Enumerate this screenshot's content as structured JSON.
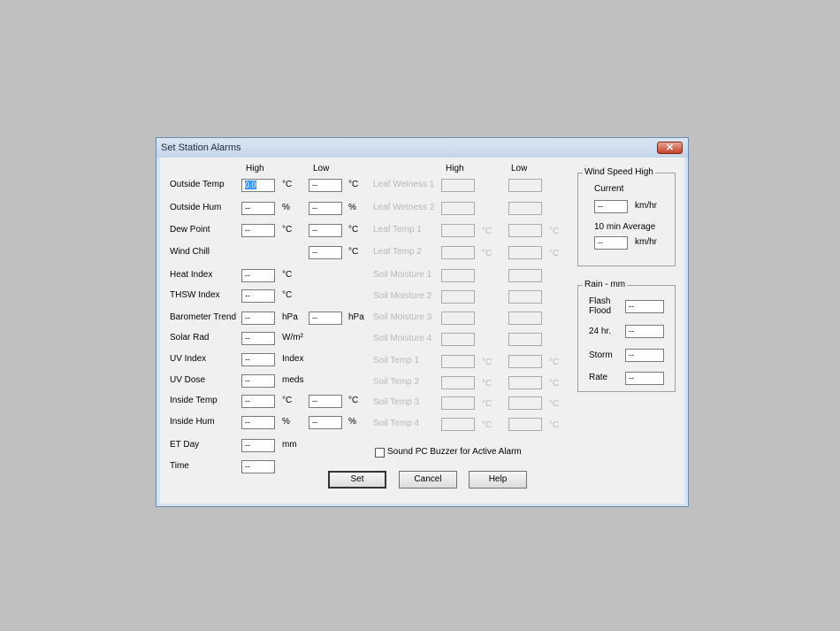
{
  "dialog": {
    "title": "Set Station Alarms",
    "close": "✕"
  },
  "headers": {
    "high": "High",
    "low": "Low",
    "high2": "High",
    "low2": "Low"
  },
  "rows": [
    {
      "label": "Outside Temp",
      "high": "0.0",
      "unit_high": "°C",
      "low": "--",
      "unit_low": "°C"
    },
    {
      "label": "Outside Hum",
      "high": "--",
      "unit_high": "%",
      "low": "--",
      "unit_low": "%"
    },
    {
      "label": "Dew Point",
      "high": "--",
      "unit_high": "°C",
      "low": "--",
      "unit_low": "°C"
    },
    {
      "label": "Wind Chill",
      "low": "--",
      "unit_low": "°C"
    },
    {
      "label": "Heat Index",
      "high": "--",
      "unit_high": "°C"
    },
    {
      "label": "THSW Index",
      "high": "--",
      "unit_high": "°C"
    },
    {
      "label": "Barometer Trend",
      "high": "--",
      "unit_high": "hPa",
      "low": "--",
      "unit_low": "hPa"
    },
    {
      "label": "Solar Rad",
      "high": "--",
      "unit_high": "W/m²"
    },
    {
      "label": "UV Index",
      "high": "--",
      "unit_high": "Index"
    },
    {
      "label": "UV Dose",
      "high": "--",
      "unit_high": "meds"
    },
    {
      "label": "Inside Temp",
      "high": "--",
      "unit_high": "°C",
      "low": "--",
      "unit_low": "°C"
    },
    {
      "label": "Inside Hum",
      "high": "--",
      "unit_high": "%",
      "low": "--",
      "unit_low": "%"
    },
    {
      "label": "ET Day",
      "high": "--",
      "unit_high": "mm"
    },
    {
      "label": "Time",
      "high": "--"
    }
  ],
  "extra_rows": [
    {
      "label": "Leaf Wetness 1",
      "unit": ""
    },
    {
      "label": "Leaf Wetness 2",
      "unit": ""
    },
    {
      "label": "Leaf Temp 1",
      "unit": "°C"
    },
    {
      "label": "Leaf Temp 2",
      "unit": "°C"
    },
    {
      "label": "Soil Moisture 1",
      "unit": ""
    },
    {
      "label": "Soil Moisture 2",
      "unit": ""
    },
    {
      "label": "Soil Moisture 3",
      "unit": ""
    },
    {
      "label": "Soil Moisture 4",
      "unit": ""
    },
    {
      "label": "Soil Temp 1",
      "unit": "°C"
    },
    {
      "label": "Soil Temp 2",
      "unit": "°C"
    },
    {
      "label": "Soil Temp 3",
      "unit": "°C"
    },
    {
      "label": "Soil Temp 4",
      "unit": "°C"
    }
  ],
  "wind": {
    "title": "Wind Speed High",
    "current_label": "Current",
    "current_value": "--",
    "current_unit": "km/hr",
    "avg_label": "10 min Average",
    "avg_value": "--",
    "avg_unit": "km/hr"
  },
  "rain": {
    "title": "Rain - mm",
    "flash_label": "Flash Flood",
    "flash_value": "--",
    "h24_label": "24 hr.",
    "h24_value": "--",
    "storm_label": "Storm",
    "storm_value": "--",
    "rate_label": "Rate",
    "rate_value": "--"
  },
  "buzzer": {
    "label": "Sound PC Buzzer for Active Alarm",
    "checked": false
  },
  "buttons": {
    "set": "Set",
    "cancel": "Cancel",
    "help": "Help"
  }
}
